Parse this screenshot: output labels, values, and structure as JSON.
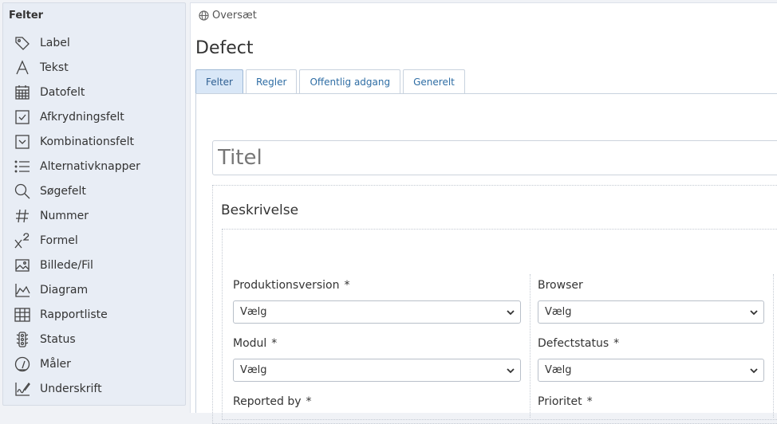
{
  "sidebar": {
    "title": "Felter",
    "items": [
      {
        "label": "Label",
        "icon": "tag-icon"
      },
      {
        "label": "Tekst",
        "icon": "text-icon"
      },
      {
        "label": "Datofelt",
        "icon": "calendar-icon"
      },
      {
        "label": "Afkrydningsfelt",
        "icon": "checkbox-icon"
      },
      {
        "label": "Kombinationsfelt",
        "icon": "dropdown-icon"
      },
      {
        "label": "Alternativknapper",
        "icon": "list-icon"
      },
      {
        "label": "Søgefelt",
        "icon": "search-icon"
      },
      {
        "label": "Nummer",
        "icon": "hash-icon"
      },
      {
        "label": "Formel",
        "icon": "formula-icon"
      },
      {
        "label": "Billede/Fil",
        "icon": "image-icon"
      },
      {
        "label": "Diagram",
        "icon": "chart-icon"
      },
      {
        "label": "Rapportliste",
        "icon": "table-icon"
      },
      {
        "label": "Status",
        "icon": "traffic-light-icon"
      },
      {
        "label": "Måler",
        "icon": "gauge-icon"
      },
      {
        "label": "Underskrift",
        "icon": "signature-icon"
      }
    ]
  },
  "header": {
    "translate_label": "Oversæt",
    "page_title": "Defect"
  },
  "tabs": [
    {
      "label": "Felter",
      "active": true
    },
    {
      "label": "Regler",
      "active": false
    },
    {
      "label": "Offentlig adgang",
      "active": false
    },
    {
      "label": "Generelt",
      "active": false
    }
  ],
  "form": {
    "title_placeholder": "Titel",
    "section_title": "Beskrivelse",
    "fields": [
      {
        "label": "Produktionsversion",
        "required": "*",
        "value": "Vælg"
      },
      {
        "label": "Browser",
        "required": "",
        "value": "Vælg"
      },
      {
        "label": "Modul",
        "required": "*",
        "value": "Vælg"
      },
      {
        "label": "Defectstatus",
        "required": "*",
        "value": "Vælg"
      },
      {
        "label": "Reported by",
        "required": "*",
        "value": ""
      },
      {
        "label": "Prioritet",
        "required": "*",
        "value": ""
      }
    ]
  }
}
